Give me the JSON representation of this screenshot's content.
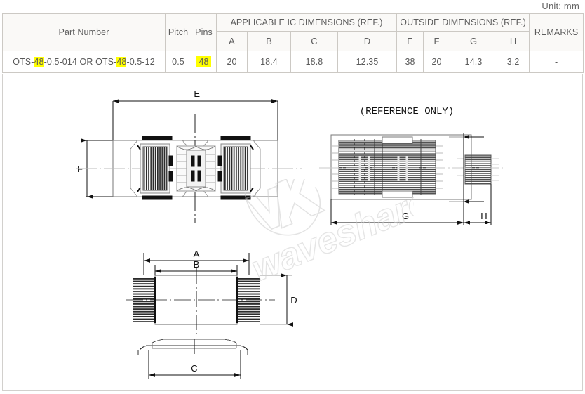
{
  "unit_label": "Unit: mm",
  "table": {
    "group_headers": {
      "part_number": "Part Number",
      "pitch": "Pitch",
      "pins": "Pins",
      "applicable_ic": "APPLICABLE IC DIMENSIONS (REF.)",
      "outside": "OUTSIDE DIMENSIONS (REF.)",
      "remarks": "REMARKS"
    },
    "sub_headers": {
      "a": "A",
      "b": "B",
      "c": "C",
      "d": "D",
      "e": "E",
      "f": "F",
      "g": "G",
      "h": "H"
    },
    "row": {
      "part_number_prefix1": "OTS-",
      "part_number_hl1": "48",
      "part_number_mid": "-0.5-014 OR OTS-",
      "part_number_hl2": "48",
      "part_number_suffix": "-0.5-12",
      "part_number_full": "OTS-48-0.5-014 OR OTS-48-0.5-12",
      "pitch": "0.5",
      "pins": "48",
      "a": "20",
      "b": "18.4",
      "c": "18.8",
      "d": "12.35",
      "e": "38",
      "f": "20",
      "g": "14.3",
      "h": "3.2",
      "remarks": "-"
    },
    "highlight_color": "#ffff00"
  },
  "drawing": {
    "top_view": {
      "dim_e_label": "E",
      "dim_f_label": "F"
    },
    "side_view": {
      "note": "(REFERENCE ONLY)",
      "dim_g_label": "G",
      "dim_h_label": "H"
    },
    "bottom_view": {
      "dim_a_label": "A",
      "dim_b_label": "B",
      "dim_d_label": "D"
    },
    "profile_view": {
      "dim_c_label": "C"
    },
    "watermark_text": "waveshare"
  }
}
